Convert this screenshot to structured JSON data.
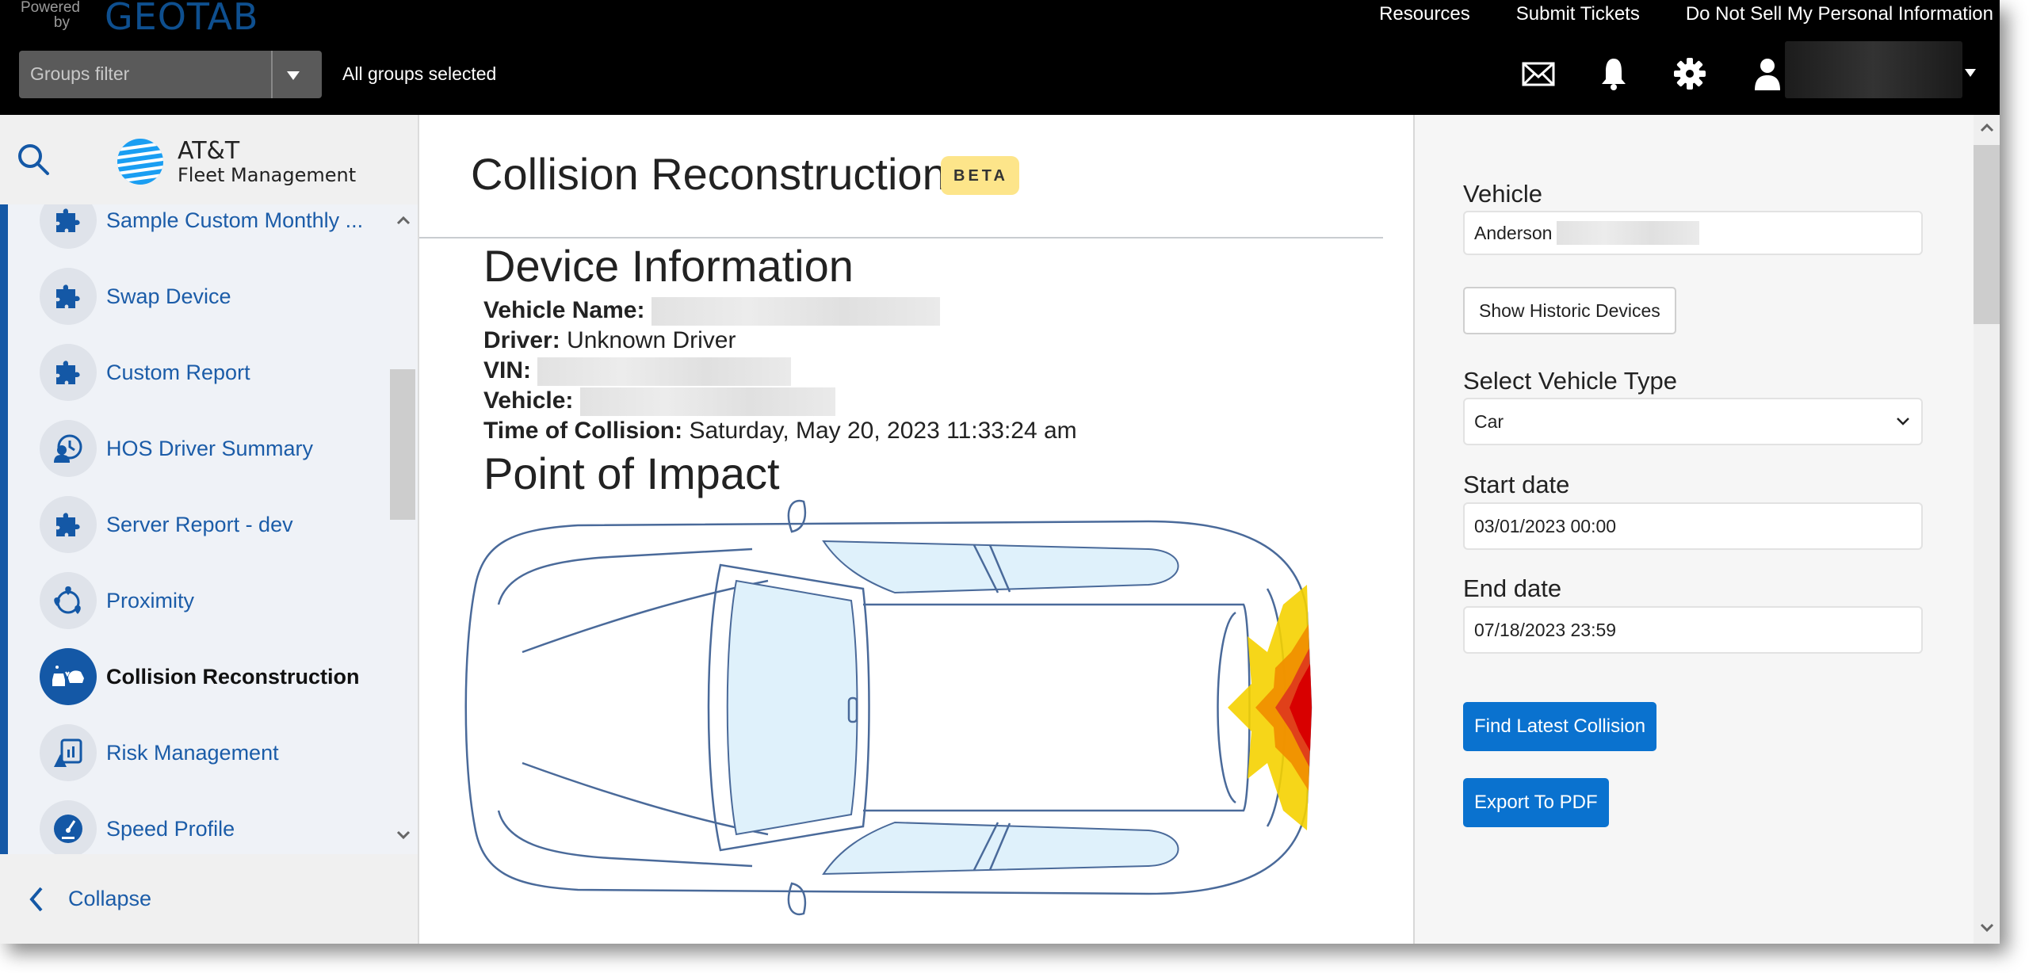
{
  "header": {
    "powered_by": "Powered by",
    "brand": "GEOTAB",
    "links": [
      "Resources",
      "Submit Tickets",
      "Do Not Sell My Personal Information"
    ],
    "groups_filter_placeholder": "Groups filter",
    "groups_status": "All groups selected",
    "icons": [
      "mail-icon",
      "bell-icon",
      "gear-icon",
      "user-icon"
    ]
  },
  "sidebar": {
    "brand_line1": "AT&T",
    "brand_line2": "Fleet Management",
    "items": [
      {
        "label": "Sample Custom Monthly ...",
        "icon": "puzzle-icon",
        "active": false
      },
      {
        "label": "Swap Device",
        "icon": "puzzle-icon",
        "active": false
      },
      {
        "label": "Custom Report",
        "icon": "puzzle-icon",
        "active": false
      },
      {
        "label": "HOS Driver Summary",
        "icon": "driver-clock-icon",
        "active": false
      },
      {
        "label": "Server Report - dev",
        "icon": "puzzle-icon",
        "active": false
      },
      {
        "label": "Proximity",
        "icon": "proximity-icon",
        "active": false
      },
      {
        "label": "Collision Reconstruction",
        "icon": "collision-icon",
        "active": true
      },
      {
        "label": "Risk Management",
        "icon": "risk-report-icon",
        "active": false
      },
      {
        "label": "Speed Profile",
        "icon": "speedometer-icon",
        "active": false
      }
    ],
    "collapse_label": "Collapse"
  },
  "main": {
    "title": "Collision Reconstruction",
    "badge": "BETA",
    "device_info_heading": "Device Information",
    "fields": {
      "vehicle_name_label": "Vehicle Name:",
      "driver_label": "Driver:",
      "driver_value": "Unknown Driver",
      "vin_label": "VIN:",
      "vehicle_label": "Vehicle:",
      "time_label": "Time of Collision:",
      "time_value": "Saturday, May 20, 2023 11:33:24 am"
    },
    "impact_heading": "Point of Impact",
    "impact": {
      "location": "rear",
      "colors": [
        "#f5d100",
        "#f09000",
        "#e0401a",
        "#d80000"
      ]
    }
  },
  "panel": {
    "vehicle_label": "Vehicle",
    "vehicle_value": "Anderson",
    "historic_button": "Show Historic Devices",
    "vehicle_type_label": "Select Vehicle Type",
    "vehicle_type_value": "Car",
    "start_label": "Start date",
    "start_value": "03/01/2023 00:00",
    "end_label": "End date",
    "end_value": "07/18/2023 23:59",
    "find_button": "Find Latest Collision",
    "export_button": "Export To PDF",
    "accent": "#0a72cf"
  }
}
